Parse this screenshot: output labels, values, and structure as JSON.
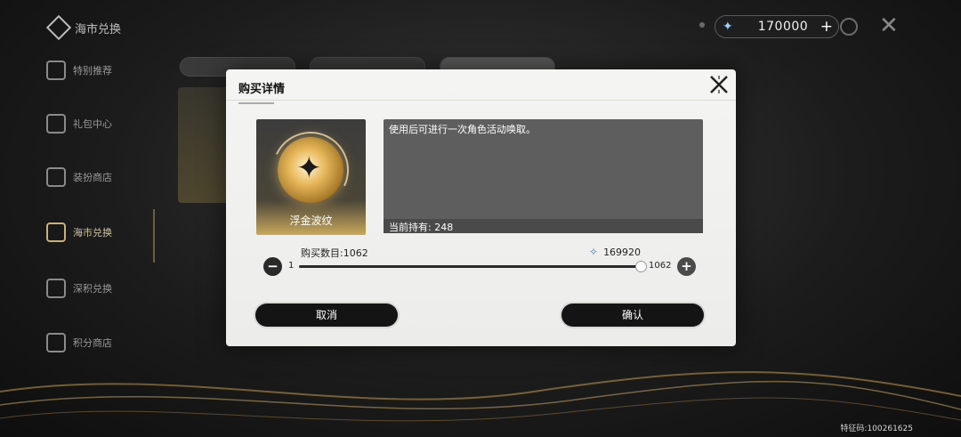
{
  "nav": {
    "title": "海市兑换",
    "items": [
      {
        "label": "特别推荐",
        "active": false
      },
      {
        "label": "礼包中心",
        "active": false
      },
      {
        "label": "装扮商店",
        "active": false
      },
      {
        "label": "海市兑换",
        "active": true
      },
      {
        "label": "深积兑换",
        "active": false
      },
      {
        "label": "积分商店",
        "active": false
      }
    ]
  },
  "currency": {
    "amount": "170000",
    "plus": "+",
    "icon": "star-crystal-icon"
  },
  "top_close": "✕",
  "uid": {
    "label": "特征码:",
    "value": "100261625"
  },
  "modal": {
    "title": "购买详情",
    "mini": "",
    "item": {
      "name": "浮金波纹",
      "icon": "golden-orb-icon"
    },
    "description": "使用后可进行一次角色活动唤取。",
    "holding": {
      "label": "当前持有:",
      "value": "248"
    },
    "quantity": {
      "label": "购买数目:",
      "value": "1062"
    },
    "cost": {
      "value": "169920",
      "icon": "star-crystal-icon"
    },
    "slider": {
      "min": "1",
      "max": "1062",
      "fraction": 1.0
    },
    "buttons": {
      "cancel": "取消",
      "confirm": "确认"
    }
  },
  "colors": {
    "modal_bg": "#f0f0ee",
    "button_bg": "#141414",
    "accent_gold": "#c9a95a"
  }
}
